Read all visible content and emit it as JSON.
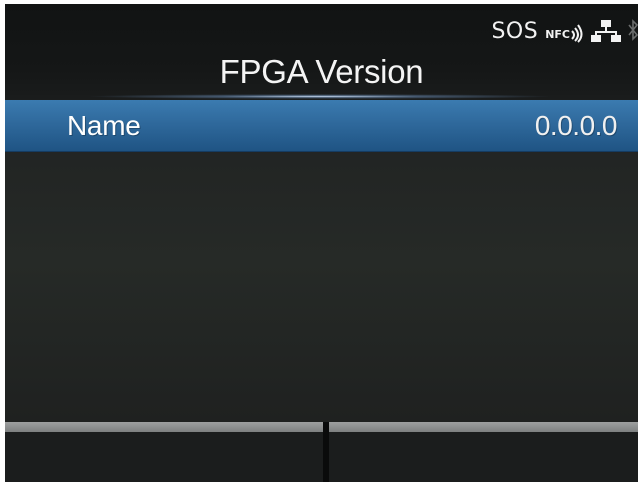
{
  "status_bar": {
    "sos_label": "SOS",
    "nfc_label": "NFC",
    "icons": [
      "nfc-icon",
      "wired-lan-icon",
      "bluetooth-icon"
    ]
  },
  "page": {
    "title": "FPGA Version"
  },
  "items": [
    {
      "label": "Name",
      "value": "0.0.0.0",
      "selected": true
    }
  ],
  "softkeys": {
    "left_label": "",
    "right_label": ""
  },
  "colors": {
    "screen_background": "#1b1d1d",
    "selection_highlight": "#2f699c",
    "text": "#ffffff",
    "softkey_bar": "#8a8c8c"
  }
}
